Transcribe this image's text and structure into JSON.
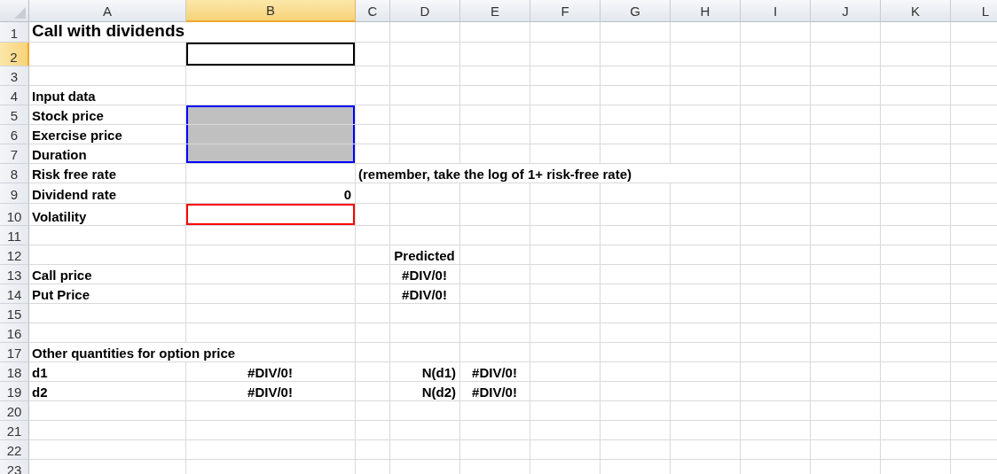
{
  "columns": [
    {
      "label": "A",
      "selected": false
    },
    {
      "label": "B",
      "selected": true
    },
    {
      "label": "C",
      "selected": false
    },
    {
      "label": "D",
      "selected": false
    },
    {
      "label": "E",
      "selected": false
    },
    {
      "label": "F",
      "selected": false
    },
    {
      "label": "G",
      "selected": false
    },
    {
      "label": "H",
      "selected": false
    },
    {
      "label": "I",
      "selected": false
    },
    {
      "label": "J",
      "selected": false
    },
    {
      "label": "K",
      "selected": false
    },
    {
      "label": "L",
      "selected": false
    }
  ],
  "rows": [
    {
      "number": "1",
      "selected": false,
      "cells": {
        "A": {
          "text": "Call with dividends",
          "kind": "title"
        }
      }
    },
    {
      "number": "2",
      "selected": true,
      "cells": {
        "B": {
          "selected": true
        }
      }
    },
    {
      "number": "3",
      "selected": false,
      "cells": {}
    },
    {
      "number": "4",
      "selected": false,
      "cells": {
        "A": {
          "text": "Input data",
          "kind": "label"
        }
      }
    },
    {
      "number": "5",
      "selected": false,
      "cells": {
        "A": {
          "text": "Stock price",
          "kind": "label"
        },
        "B": {
          "shaded": true,
          "color": "#0000ff"
        }
      }
    },
    {
      "number": "6",
      "selected": false,
      "cells": {
        "A": {
          "text": "Exercise price",
          "kind": "label"
        },
        "B": {
          "shaded": true,
          "color": "#0000ff"
        }
      }
    },
    {
      "number": "7",
      "selected": false,
      "cells": {
        "A": {
          "text": "Duration",
          "kind": "label"
        },
        "B": {
          "shaded": true,
          "color": "#0000ff"
        }
      }
    },
    {
      "number": "8",
      "selected": false,
      "cells": {
        "A": {
          "text": "Risk free rate",
          "kind": "label"
        },
        "C": {
          "text": "(remember, take the log of 1+ risk-free rate)",
          "kind": "label"
        }
      }
    },
    {
      "number": "9",
      "selected": false,
      "cells": {
        "A": {
          "text": "Dividend rate",
          "kind": "label"
        },
        "B": {
          "text": "0",
          "kind": "number"
        }
      }
    },
    {
      "number": "10",
      "selected": false,
      "cells": {
        "A": {
          "text": "Volatility",
          "kind": "label"
        },
        "B": {
          "shaded": false,
          "color": "#ff0000"
        }
      }
    },
    {
      "number": "11",
      "selected": false,
      "cells": {}
    },
    {
      "number": "12",
      "selected": false,
      "cells": {
        "D": {
          "text": "Predicted",
          "kind": "error"
        }
      }
    },
    {
      "number": "13",
      "selected": false,
      "cells": {
        "A": {
          "text": "Call price",
          "kind": "label"
        },
        "D": {
          "text": "#DIV/0!",
          "kind": "error"
        }
      }
    },
    {
      "number": "14",
      "selected": false,
      "cells": {
        "A": {
          "text": "Put Price",
          "kind": "label"
        },
        "D": {
          "text": "#DIV/0!",
          "kind": "error"
        }
      }
    },
    {
      "number": "15",
      "selected": false,
      "cells": {}
    },
    {
      "number": "16",
      "selected": false,
      "cells": {}
    },
    {
      "number": "17",
      "selected": false,
      "cells": {
        "A": {
          "text": "Other quantities for option price",
          "kind": "label"
        }
      }
    },
    {
      "number": "18",
      "selected": false,
      "cells": {
        "A": {
          "text": "d1",
          "kind": "label"
        },
        "B": {
          "text": "#DIV/0!",
          "kind": "error"
        },
        "D": {
          "text": "N(d1)",
          "kind": "number"
        },
        "E": {
          "text": "#DIV/0!",
          "kind": "error"
        }
      }
    },
    {
      "number": "19",
      "selected": false,
      "cells": {
        "A": {
          "text": "d2",
          "kind": "label"
        },
        "B": {
          "text": "#DIV/0!",
          "kind": "error"
        },
        "D": {
          "text": "N(d2)",
          "kind": "number"
        },
        "E": {
          "text": "#DIV/0!",
          "kind": "error"
        }
      }
    },
    {
      "number": "20",
      "selected": false,
      "cells": {}
    },
    {
      "number": "21",
      "selected": false,
      "cells": {}
    },
    {
      "number": "22",
      "selected": false,
      "cells": {}
    },
    {
      "number": "23",
      "selected": false,
      "cells": {}
    }
  ]
}
